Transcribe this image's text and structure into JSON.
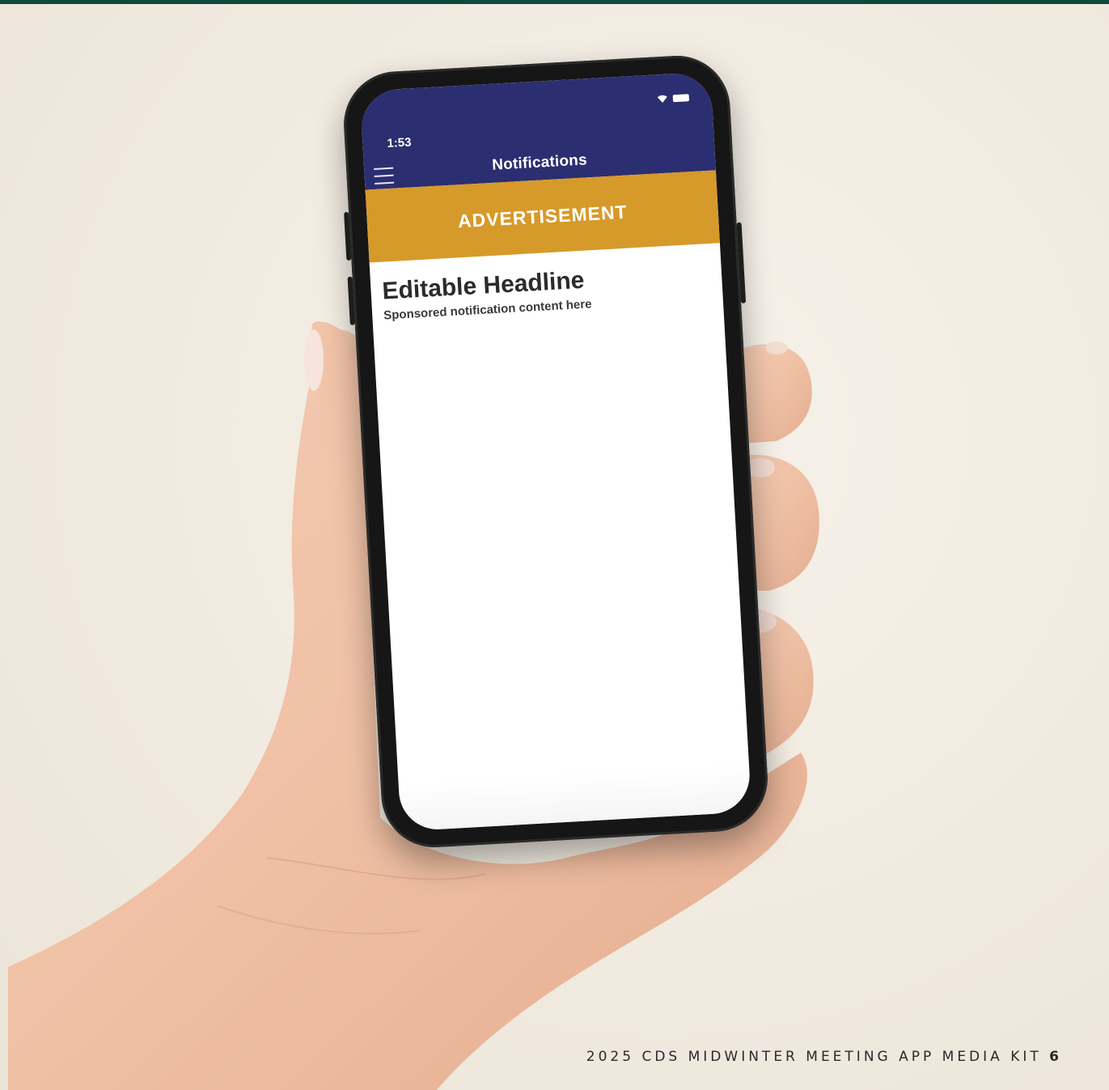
{
  "footer": {
    "title": "2025 CDS MIDWINTER MEETING APP MEDIA KIT",
    "page_number": "6"
  },
  "phone": {
    "status_time": "1:53",
    "header_title": "Notifications",
    "ad_banner": "ADVERTISEMENT",
    "notification": {
      "headline": "Editable Headline",
      "body": "Sponsored notification content here"
    }
  },
  "icons": [
    "wifi-icon",
    "battery-icon",
    "menu-icon"
  ],
  "colors": {
    "top_bar": "#0e4a3c",
    "header": "#2b2e70",
    "ad_banner": "#d69a2a",
    "background": "#f3ede4"
  }
}
